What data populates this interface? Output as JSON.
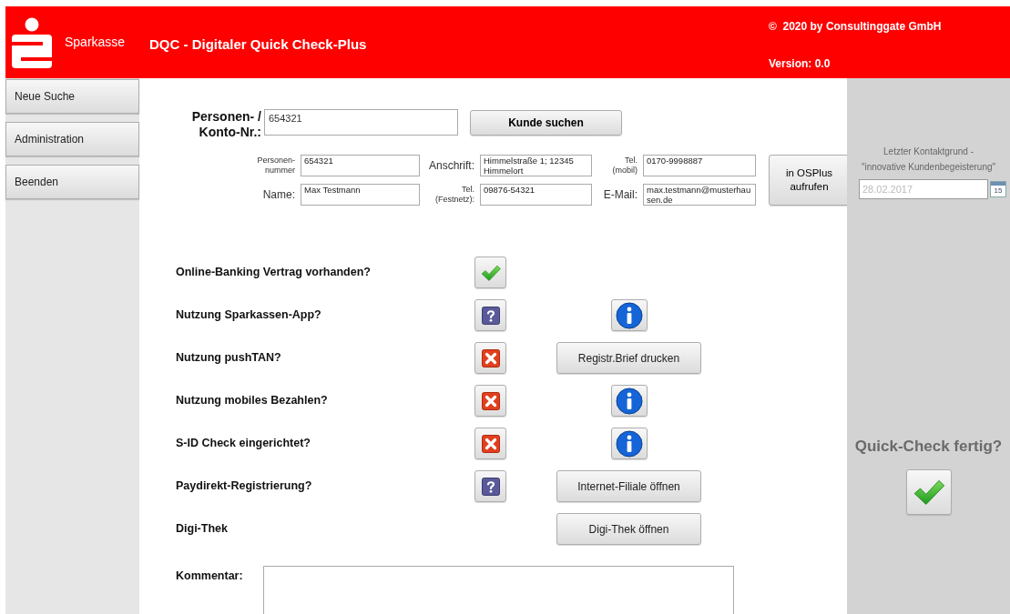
{
  "header": {
    "brand": "Sparkasse",
    "title": "DQC - Digitaler Quick Check-Plus",
    "copyright": "©  2020 by Consultinggate GmbH",
    "version": "Version: 0.0"
  },
  "sidebar": {
    "items": [
      {
        "label": "Neue Suche"
      },
      {
        "label": "Administration"
      },
      {
        "label": "Beenden"
      }
    ]
  },
  "search": {
    "label_lines": [
      "Personen- /",
      "Konto-Nr.:"
    ],
    "value": "654321",
    "button": "Kunde suchen"
  },
  "customer": {
    "fields": [
      {
        "kind": "stacked",
        "label_lines": [
          "Personen-",
          "nummer"
        ],
        "value": "654321"
      },
      {
        "kind": "plain",
        "label_lines": [
          "Anschrift:"
        ],
        "value": "Himmelstraße 1; 12345 Himmelort"
      },
      {
        "kind": "stacked",
        "label_lines": [
          "Tel.",
          "(mobil)"
        ],
        "value": "0170-9998887"
      },
      {
        "kind": "plain",
        "label_lines": [
          "Name:"
        ],
        "value": "Max Testmann"
      },
      {
        "kind": "stacked",
        "label_lines": [
          "Tel.",
          "(Festnetz):"
        ],
        "value": "09876-54321"
      },
      {
        "kind": "plain",
        "label_lines": [
          "E-Mail:"
        ],
        "value": "max.testmann@musterhausen.de"
      }
    ],
    "button": "in OSPlus aufrufen"
  },
  "checks": [
    {
      "label": "Online-Banking Vertrag vorhanden?",
      "kind": "yes"
    },
    {
      "label": "Nutzung Sparkassen-App?",
      "kind": "unknown",
      "action": {
        "kind": "info"
      }
    },
    {
      "label": "Nutzung pushTAN?",
      "kind": "no",
      "action": {
        "kind": "button",
        "label": "Registr.Brief drucken"
      }
    },
    {
      "label": "Nutzung mobiles Bezahlen?",
      "kind": "no",
      "action": {
        "kind": "info"
      }
    },
    {
      "label": "S-ID Check eingerichtet?",
      "kind": "no",
      "action": {
        "kind": "info"
      }
    },
    {
      "label": "Paydirekt-Registrierung?",
      "kind": "unknown",
      "action": {
        "kind": "button",
        "label": "Internet-Filiale öffnen"
      }
    },
    {
      "label": "Digi-Thek",
      "kind": "none",
      "action": {
        "kind": "button",
        "label": "Digi-Thek öffnen"
      }
    }
  ],
  "comment": {
    "label": "Kommentar:"
  },
  "right_panel": {
    "caption_lines": [
      "Letzter Kontaktgrund -",
      "\"innovative Kundenbegeisterung\""
    ],
    "date": "28.02.2017",
    "calendar_day": "15",
    "question": "Quick-Check fertig?"
  }
}
